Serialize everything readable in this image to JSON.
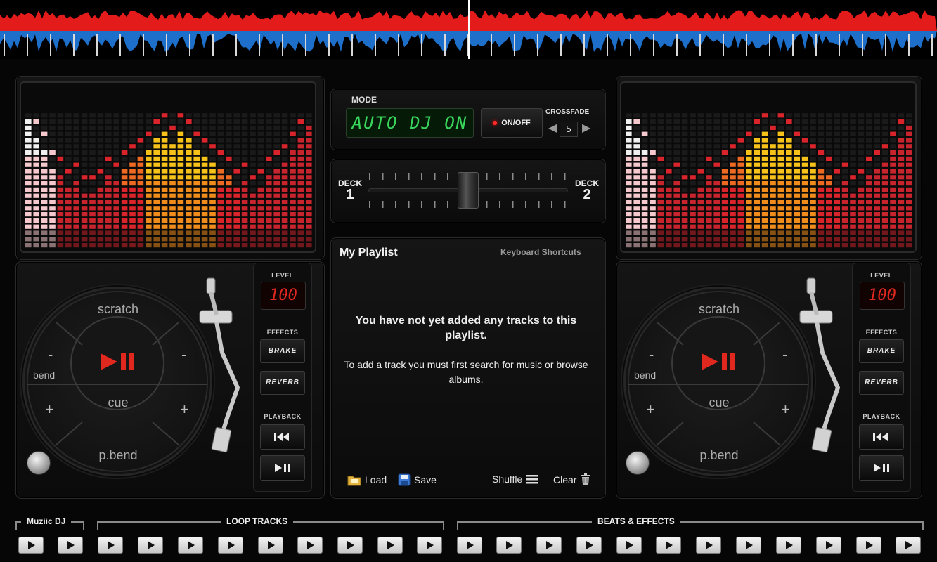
{
  "colors": {
    "accent_red": "#e0281e",
    "lcd_green": "#39d65c",
    "waveform_red": "#e31b1b",
    "waveform_blue": "#1d6fc9"
  },
  "deck_left": {
    "pads": {
      "top": "scratch",
      "bottom": "p.bend",
      "center": "cue",
      "bend": "bend",
      "minus": "-",
      "plus": "+"
    },
    "level_title": "LEVEL",
    "level_value": "100",
    "effects_title": "EFFECTS",
    "effects": [
      "BRAKE",
      "REVERB"
    ],
    "playback_title": "PLAYBACK",
    "playback_icons": [
      "skip-back-icon",
      "play-pause-icon"
    ]
  },
  "deck_right": {
    "pads": {
      "top": "scratch",
      "bottom": "p.bend",
      "center": "cue",
      "bend": "bend",
      "minus": "-",
      "plus": "+"
    },
    "level_title": "LEVEL",
    "level_value": "100",
    "effects_title": "EFFECTS",
    "effects": [
      "BRAKE",
      "REVERB"
    ],
    "playback_title": "PLAYBACK",
    "playback_icons": [
      "skip-back-icon",
      "play-pause-icon"
    ]
  },
  "mode": {
    "label": "MODE",
    "display": "AUTO DJ ON",
    "toggle_label": "ON/OFF",
    "crossfade_label": "CROSSFADE",
    "crossfade_value": "5"
  },
  "mixer": {
    "deck1_label": "DECK",
    "deck1_num": "1",
    "deck2_label": "DECK",
    "deck2_num": "2",
    "crossfader_position": 0.5
  },
  "playlist": {
    "title": "My Playlist",
    "shortcuts_link": "Keyboard Shortcuts",
    "empty_line1": "You have not yet added any tracks to this playlist.",
    "empty_line2": "To add a track you must first search for music or browse albums.",
    "load": "Load",
    "save": "Save",
    "shuffle": "Shuffle",
    "clear": "Clear"
  },
  "bottom": {
    "group1": "Muziic DJ",
    "group2": "LOOP TRACKS",
    "group3": "BEATS & EFFECTS",
    "play_icon": "play-icon"
  }
}
